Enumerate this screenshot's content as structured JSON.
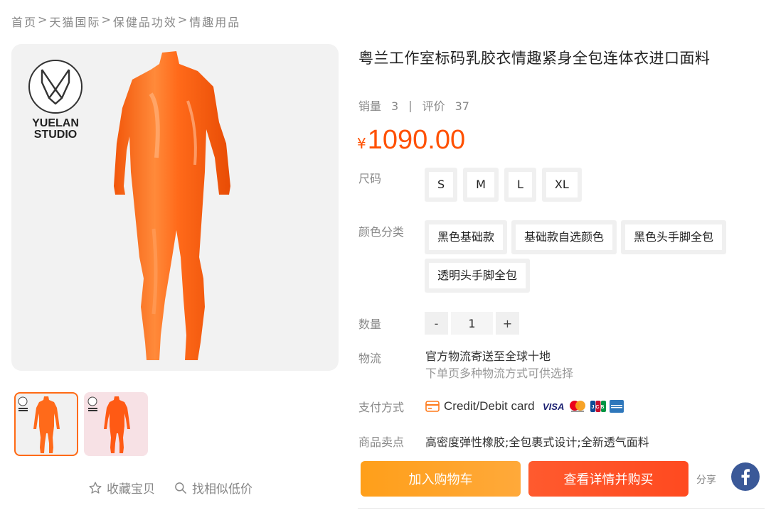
{
  "breadcrumb": [
    {
      "label": "首页"
    },
    {
      "label": "天猫国际"
    },
    {
      "label": "保健品功效"
    },
    {
      "label": "情趣用品"
    }
  ],
  "breadcrumb_separator": ">",
  "gallery": {
    "logo_text_line1": "YUELAN",
    "logo_text_line2": "STUDIO",
    "thumbnail_count": 2,
    "active_thumbnail": 0
  },
  "actions": {
    "favorite_label": "收藏宝贝",
    "similar_label": "找相似低价"
  },
  "product": {
    "title": "粤兰工作室标码乳胶衣情趣紧身全包连体衣进口面料",
    "sales_label": "销量",
    "sales_value": "3",
    "stats_divider": "|",
    "reviews_label": "评价",
    "reviews_value": "37",
    "currency_symbol": "¥",
    "price": "1090.00",
    "price_color": "#ff5000"
  },
  "size": {
    "label": "尺码",
    "options": [
      "S",
      "M",
      "L",
      "XL"
    ]
  },
  "color": {
    "label": "颜色分类",
    "options": [
      "黑色基础款",
      "基础款自选颜色",
      "黑色头手脚全包",
      "透明头手脚全包"
    ]
  },
  "quantity": {
    "label": "数量",
    "minus": "-",
    "value": "1",
    "plus": "+"
  },
  "logistics": {
    "label": "物流",
    "line1": "官方物流寄送至全球十地",
    "line2": "下单页多种物流方式可供选择"
  },
  "payment": {
    "label": "支付方式",
    "method": "Credit/Debit card",
    "cards": [
      "visa",
      "mastercard",
      "jcb",
      "american-express"
    ]
  },
  "selling_points": {
    "label": "商品卖点",
    "text": "高密度弹性橡胶;全包裹式设计;全新透气面料"
  },
  "buttons": {
    "add_to_cart": "加入购物车",
    "buy_now": "查看详情并购买",
    "share": "分享"
  },
  "colors": {
    "accent": "#ff5000",
    "cart_button": "#ffa21f",
    "buy_button": "#ff5226",
    "facebook": "#3b5998",
    "suit_orange": "#ff6a1a"
  }
}
